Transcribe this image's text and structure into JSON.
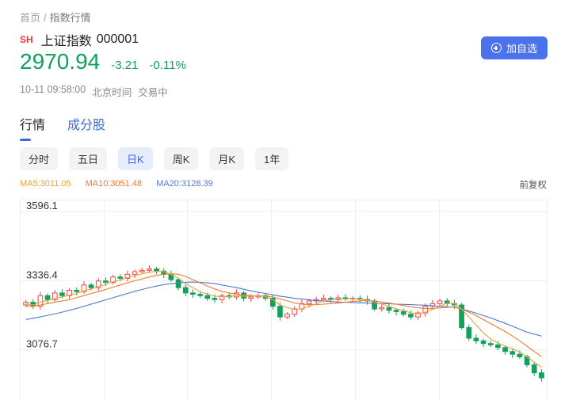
{
  "breadcrumb": {
    "home": "首页",
    "sep": "/",
    "current": "指数行情"
  },
  "stock": {
    "market": "SH",
    "name": "上证指数",
    "code": "000001",
    "price": "2970.94",
    "change": "-3.21",
    "change_pct": "-0.11%",
    "datetime": "10-11 09:58:00",
    "timezone": "北京时间",
    "status": "交易中"
  },
  "actions": {
    "add_watchlist": "加自选"
  },
  "tabs": [
    {
      "label": "行情"
    },
    {
      "label": "成分股"
    }
  ],
  "periods": [
    {
      "label": "分时"
    },
    {
      "label": "五日"
    },
    {
      "label": "日K"
    },
    {
      "label": "周K"
    },
    {
      "label": "月K"
    },
    {
      "label": "1年"
    }
  ],
  "ma": {
    "ma5": "MA5:3011.05",
    "ma10": "MA10:3051.48",
    "ma20": "MA20:3128.39"
  },
  "adjust_label": "前复权",
  "colors": {
    "up": "#e84a4a",
    "down": "#12a05c",
    "ma5": "#e8a33b",
    "ma10": "#ef7b31",
    "ma20": "#4f79d6",
    "accent": "#4a72ec"
  },
  "chart_data": {
    "type": "candlestick",
    "y_tick_labels": [
      "3596.1",
      "3336.4",
      "3076.7"
    ],
    "ylim": [
      2881.9,
      3596.1
    ],
    "grid": true,
    "closes": [
      3255,
      3240,
      3280,
      3265,
      3290,
      3280,
      3300,
      3295,
      3320,
      3310,
      3335,
      3330,
      3350,
      3345,
      3360,
      3370,
      3375,
      3380,
      3372,
      3360,
      3340,
      3310,
      3290,
      3285,
      3280,
      3270,
      3265,
      3280,
      3275,
      3290,
      3270,
      3275,
      3280,
      3270,
      3240,
      3200,
      3210,
      3230,
      3250,
      3260,
      3265,
      3270,
      3265,
      3272,
      3268,
      3270,
      3266,
      3260,
      3230,
      3235,
      3225,
      3220,
      3210,
      3200,
      3215,
      3240,
      3250,
      3260,
      3250,
      3245,
      3160,
      3120,
      3110,
      3100,
      3095,
      3085,
      3070,
      3060,
      3050,
      3020,
      2990,
      2971
    ],
    "ma5_values": [
      3250,
      3245,
      3255,
      3262,
      3270,
      3275,
      3282,
      3288,
      3298,
      3305,
      3315,
      3322,
      3332,
      3338,
      3348,
      3356,
      3362,
      3368,
      3371,
      3370,
      3360,
      3345,
      3325,
      3310,
      3295,
      3285,
      3278,
      3276,
      3276,
      3280,
      3278,
      3278,
      3280,
      3276,
      3265,
      3245,
      3235,
      3228,
      3230,
      3240,
      3250,
      3260,
      3265,
      3268,
      3268,
      3268,
      3267,
      3265,
      3255,
      3248,
      3240,
      3230,
      3225,
      3215,
      3212,
      3218,
      3228,
      3240,
      3252,
      3250,
      3230,
      3200,
      3170,
      3140,
      3117,
      3102,
      3090,
      3080,
      3068,
      3050,
      3030,
      3011
    ],
    "ma10_values": [
      3240,
      3240,
      3245,
      3250,
      3255,
      3260,
      3265,
      3272,
      3280,
      3288,
      3295,
      3303,
      3312,
      3320,
      3328,
      3336,
      3343,
      3350,
      3356,
      3360,
      3362,
      3360,
      3352,
      3340,
      3328,
      3316,
      3305,
      3296,
      3290,
      3286,
      3282,
      3280,
      3279,
      3278,
      3275,
      3268,
      3260,
      3252,
      3248,
      3246,
      3246,
      3248,
      3250,
      3252,
      3255,
      3258,
      3260,
      3262,
      3260,
      3256,
      3252,
      3248,
      3243,
      3238,
      3234,
      3232,
      3232,
      3234,
      3236,
      3238,
      3230,
      3218,
      3205,
      3190,
      3175,
      3160,
      3145,
      3128,
      3110,
      3090,
      3070,
      3051
    ],
    "ma20_values": [
      3190,
      3195,
      3200,
      3206,
      3212,
      3218,
      3225,
      3232,
      3240,
      3248,
      3256,
      3264,
      3272,
      3280,
      3288,
      3296,
      3303,
      3310,
      3316,
      3321,
      3325,
      3328,
      3330,
      3331,
      3330,
      3328,
      3325,
      3320,
      3315,
      3310,
      3304,
      3298,
      3293,
      3288,
      3283,
      3278,
      3274,
      3270,
      3267,
      3264,
      3262,
      3260,
      3258,
      3256,
      3255,
      3254,
      3253,
      3252,
      3251,
      3250,
      3249,
      3248,
      3247,
      3246,
      3245,
      3244,
      3242,
      3240,
      3238,
      3236,
      3230,
      3222,
      3214,
      3205,
      3196,
      3186,
      3176,
      3165,
      3154,
      3143,
      3135,
      3128
    ]
  }
}
